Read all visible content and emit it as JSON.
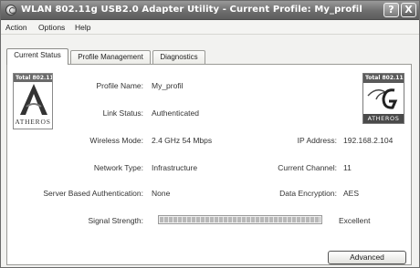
{
  "window": {
    "title": "WLAN 802.11g USB2.0 Adapter Utility - Current Profile: My_profil",
    "help_label": "?",
    "close_label": "X"
  },
  "menu": [
    "Action",
    "Options",
    "Help"
  ],
  "tabs": [
    "Current Status",
    "Profile Management",
    "Diagnostics"
  ],
  "active_tab": "Current Status",
  "logos": {
    "left_badge": "Total 802.11",
    "left_name": "ATHEROS",
    "right_badge": "Total 802.11",
    "right_name": "ATHEROS"
  },
  "status": {
    "profile_name_label": "Profile Name:",
    "profile_name": "My_profil",
    "link_status_label": "Link Status:",
    "link_status": "Authenticated",
    "wireless_mode_label": "Wireless Mode:",
    "wireless_mode": "2.4 GHz 54 Mbps",
    "ip_address_label": "IP Address:",
    "ip_address": "192.168.2.104",
    "network_type_label": "Network Type:",
    "network_type": "Infrastructure",
    "current_channel_label": "Current Channel:",
    "current_channel": "11",
    "server_auth_label": "Server Based Authentication:",
    "server_auth": "None",
    "data_encryption_label": "Data Encryption:",
    "data_encryption": "AES",
    "signal_strength_label": "Signal Strength:",
    "signal_strength_text": "Excellent",
    "signal_strength_level": 1.0
  },
  "advanced_button": "Advanced",
  "colors": {
    "titlebar": "#6e6e6e",
    "panel_background": "#ffffff",
    "window_background": "#f2f2f0"
  }
}
